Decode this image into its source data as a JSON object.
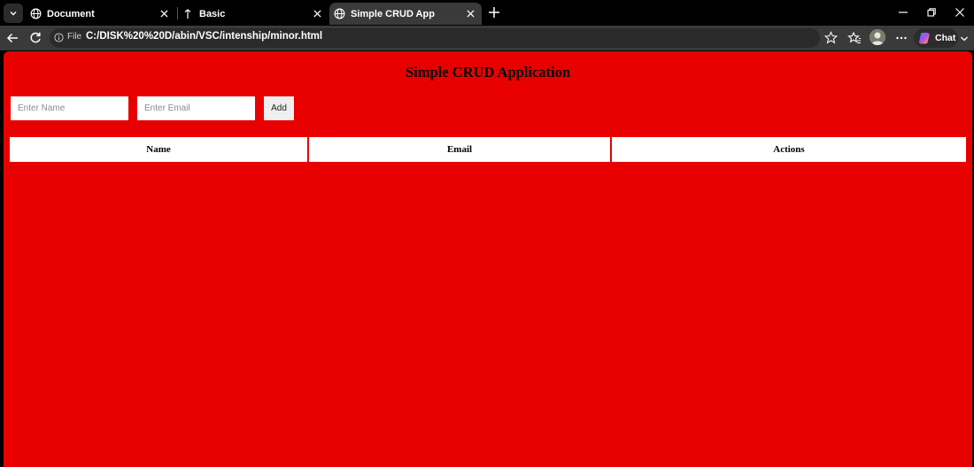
{
  "browser": {
    "tabs": [
      {
        "title": "Document",
        "icon": "globe-icon",
        "active": false
      },
      {
        "title": "Basic",
        "icon": "pin-icon",
        "active": false
      },
      {
        "title": "Simple CRUD App",
        "icon": "globe-icon",
        "active": true
      }
    ],
    "address": {
      "scheme_label": "File",
      "url": "C:/DISK%20%20D/abin/VSC/intenship/minor.html"
    },
    "chat_label": "Chat",
    "colors": {
      "frame": "#000000",
      "toolbar": "#3a3a3a",
      "page_bg": "#e80000"
    }
  },
  "page": {
    "title": "Simple CRUD Application",
    "form": {
      "name_placeholder": "Enter Name",
      "email_placeholder": "Enter Email",
      "add_label": "Add"
    },
    "table": {
      "headers": [
        "Name",
        "Email",
        "Actions"
      ],
      "rows": []
    }
  }
}
